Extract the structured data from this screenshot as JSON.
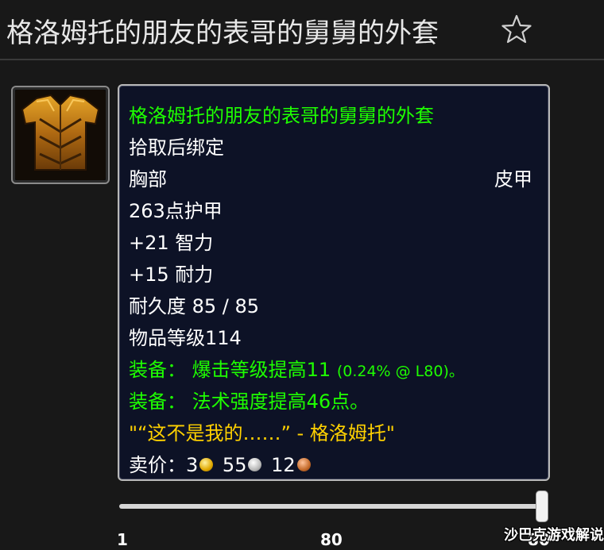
{
  "page": {
    "title": "格洛姆托的朋友的表哥的舅舅的外套",
    "favorite_icon": "star-outline-icon"
  },
  "item_icon": "chest-armor-icon",
  "tooltip": {
    "name": "格洛姆托的朋友的表哥的舅舅的外套",
    "bind": "拾取后绑定",
    "slot": "胸部",
    "armor_type": "皮甲",
    "armor": "263点护甲",
    "stat1": "+21 智力",
    "stat2": "+15 耐力",
    "durability": "耐久度 85 / 85",
    "item_level": "物品等级114",
    "equip1_label": "装备：",
    "equip1_text": "爆击等级提高11",
    "equip1_note": "(0.24% @ L80)。",
    "equip2_label": "装备：",
    "equip2_text": "法术强度提高46点。",
    "flavor": "\"“这不是我的……”  - 格洛姆托\"",
    "sell_label": "卖价：",
    "gold": "3",
    "silver": "55",
    "copper": "12"
  },
  "level_slider": {
    "min_label": "1",
    "mid_label": "80",
    "max_label": "80",
    "value_fraction": 1.0
  },
  "watermark": "沙巴克游戏解说",
  "colors": {
    "item_name": "#1eff00",
    "equip": "#1eff00",
    "flavor": "#ffd100",
    "tooltip_bg": "#0d1226"
  }
}
